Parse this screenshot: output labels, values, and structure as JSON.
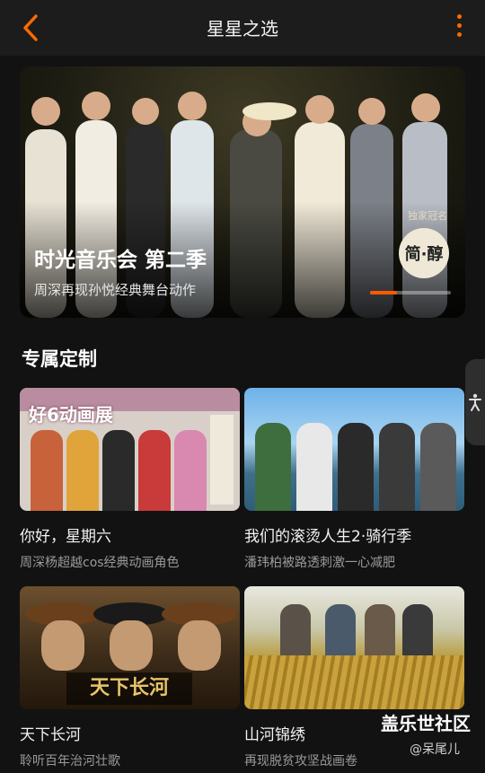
{
  "header": {
    "title": "星星之选",
    "back_icon": "chevron-left-icon",
    "more_icon": "more-vertical-icon",
    "accent_color": "#ff6a00"
  },
  "banner": {
    "title": "时光音乐会 第二季",
    "subtitle": "周深再现孙悦经典舞台动作",
    "sponsor_tag": "独家冠名",
    "sponsor_logo": "简·醇",
    "carousel_progress": 0.33
  },
  "section": {
    "title": "专属定制"
  },
  "cards": [
    {
      "title": "你好，星期六",
      "subtitle": "周深杨超越cos经典动画角色",
      "thumb_text": "好6动画展"
    },
    {
      "title": "我们的滚烫人生2·骑行季",
      "subtitle": "潘玮柏被路透刺激一心减肥"
    },
    {
      "title": "天下长河",
      "subtitle": "聆听百年治河壮歌",
      "thumb_text": "天下长河"
    },
    {
      "title": "山河锦绣",
      "subtitle": "再现脱贫攻坚战画卷"
    }
  ],
  "watermark": {
    "main": "盖乐世社区",
    "sub": "@呆尾儿"
  }
}
